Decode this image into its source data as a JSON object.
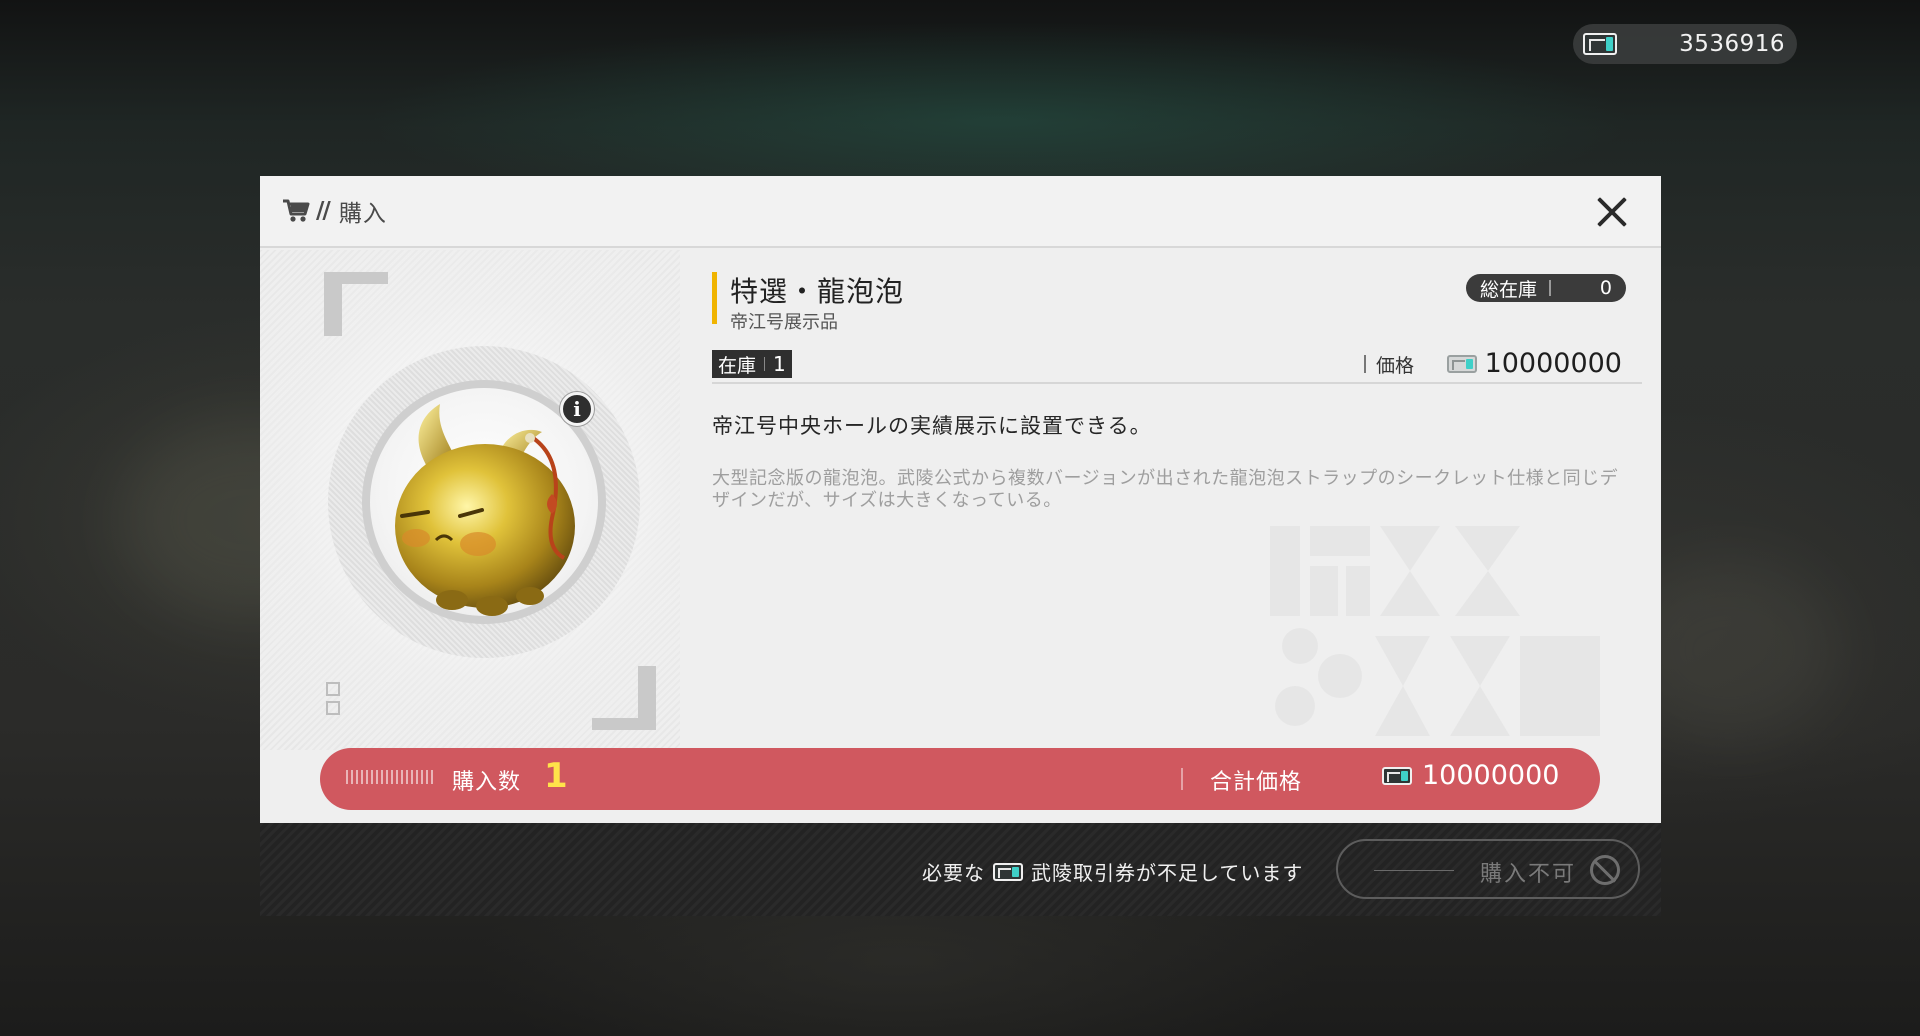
{
  "hud": {
    "currency_icon": "ticket-icon",
    "currency_amount": "3536916"
  },
  "modal": {
    "header": {
      "cart_icon": "cart-icon",
      "slash": "//",
      "title": "購入",
      "close_icon": "close-icon"
    },
    "item": {
      "name": "特選・龍泡泡",
      "subtitle": "帝江号展示品",
      "total_stock_label": "総在庫",
      "total_stock_value": "0",
      "stock_label": "在庫",
      "stock_value": "1",
      "price_label": "価格",
      "price_value": "10000000",
      "description_main": "帝江号中央ホールの実績展示に設置できる。",
      "description_sub": "大型記念版の龍泡泡。武陵公式から複数バージョンが出された龍泡泡ストラップのシークレット仕様と同じデザインだが、サイズは大きくなっている。",
      "info_icon": "info-icon",
      "info_glyph": "i"
    },
    "purchase": {
      "quantity_label": "購入数",
      "quantity_value": "1",
      "total_label": "合計価格",
      "total_value": "10000000"
    },
    "footer": {
      "msg_prefix": "必要な",
      "msg_suffix": "武陵取引券が不足しています",
      "button_label": "購入不可",
      "button_icon": "ban-icon"
    }
  },
  "colors": {
    "accent": "#f0b400",
    "purchase_bar": "#d0585f",
    "quantity": "#ffe34a",
    "ticket_teal": "#3fd0c8"
  }
}
